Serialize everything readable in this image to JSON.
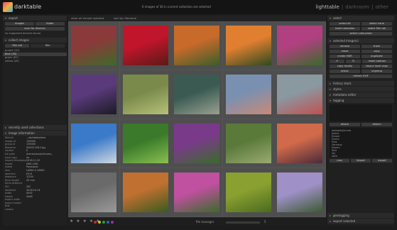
{
  "app": {
    "title": "darktable",
    "status": "6 images of 30 in current collection are selected"
  },
  "views": {
    "lighttable": "lighttable",
    "darkroom": "darkroom",
    "other": "other"
  },
  "center_top": {
    "view": "view: all except rejected",
    "sort": "sort by: filename"
  },
  "left": {
    "export": {
      "header": "export",
      "btn_images": "images",
      "btn_folder": "folder",
      "btn_scan": "scan for devices",
      "no_camera": "no supported devices found"
    },
    "collect": {
      "header": "collect images",
      "filter_label": "film roll",
      "filter_value": "film",
      "rows": [
        "purple (10)",
        "blue (20)",
        "green (87)",
        "yellow (45)"
      ]
    },
    "recent": {
      "header": "recently used collections"
    },
    "info": {
      "header": "image information",
      "rows": [
        {
          "k": "filmroll",
          "v": "...darktable/test"
        },
        {
          "k": "image id",
          "v": "135000"
        },
        {
          "k": "group id",
          "v": "135000"
        },
        {
          "k": "filename",
          "v": "DSC02128.2.jpg"
        },
        {
          "k": "version",
          "v": "0"
        },
        {
          "k": "full path",
          "v": "/home/user/pictures/..."
        },
        {
          "k": "local copy",
          "v": "no"
        },
        {
          "k": "import timestamp",
          "v": "2018.11.20"
        },
        {
          "k": "model",
          "v": "DMC-GM1"
        },
        {
          "k": "maker",
          "v": "Panasonic"
        },
        {
          "k": "lens",
          "v": "LUMIX G VARIO"
        },
        {
          "k": "aperture",
          "v": "f/5.6"
        },
        {
          "k": "exposure",
          "v": "1/250"
        },
        {
          "k": "focal length",
          "v": "42 mm"
        },
        {
          "k": "focus distance",
          "v": ""
        },
        {
          "k": "ISO",
          "v": "200"
        },
        {
          "k": "datetime",
          "v": "2018:10:14"
        },
        {
          "k": "width",
          "v": "4592"
        },
        {
          "k": "height",
          "v": "3448"
        },
        {
          "k": "export width",
          "v": ""
        },
        {
          "k": "export height",
          "v": ""
        },
        {
          "k": "title",
          "v": ""
        },
        {
          "k": "creator",
          "v": ""
        }
      ]
    }
  },
  "right": {
    "select": {
      "header": "select",
      "all": "select all",
      "none": "select none",
      "invert": "invert selection",
      "film": "select film roll",
      "untouched": "select untouched"
    },
    "selected": {
      "header": "selected image(s)",
      "remove": "remove",
      "delete": "trash",
      "move": "move",
      "copy": "copy",
      "create_hdr": "create HDR",
      "duplicate": "duplicate",
      "rotate_ccw": "↺",
      "rotate_cw": "↻",
      "reset_rotation": "reset rotation",
      "copy_locally": "copy locally",
      "resync": "resync local copy",
      "group": "group",
      "ungroup": "ungroup",
      "refresh_exif": "refresh EXIF"
    },
    "history": {
      "header": "history stack"
    },
    "styles": {
      "header": "styles"
    },
    "metadata": {
      "header": "metadata editor"
    },
    "tagging": {
      "header": "tagging",
      "attach": "attach",
      "detach": "detach",
      "new": "new",
      "import": "import",
      "export": "export",
      "tags": [
        "darktable|format",
        "places",
        "Europe",
        "France",
        "Paris",
        "Germany",
        "flowers",
        "field",
        "sky",
        "other"
      ]
    },
    "geotagging": {
      "header": "geotagging"
    },
    "export_sel": {
      "header": "export selected"
    }
  },
  "bottom": {
    "stars": "★ ★ ★ ★ ★",
    "layout": "file manager",
    "zoom_label": "5"
  },
  "colors": {
    "accent": "#b5b5b5",
    "panel": "#202020",
    "center_bg": "#555555"
  },
  "thumbnails": [
    {
      "name": "red-flowers-tree",
      "colors": [
        "#8a3a3a",
        "#3c6b2a"
      ]
    },
    {
      "name": "red-rose",
      "colors": [
        "#c0152a",
        "#5a1a18"
      ]
    },
    {
      "name": "orange-tree-garden",
      "colors": [
        "#c76a2a",
        "#3b5e2a"
      ]
    },
    {
      "name": "orange-flower",
      "colors": [
        "#e07f30",
        "#2c4a20"
      ]
    },
    {
      "name": "pink-purple-flowers",
      "colors": [
        "#b04080",
        "#3a6a2a"
      ]
    },
    {
      "name": "purple-iris",
      "colors": [
        "#5a3a7a",
        "#1b1b25"
      ]
    },
    {
      "name": "butterfly-on-plant",
      "colors": [
        "#7a8a4a",
        "#b6c27a"
      ]
    },
    {
      "name": "duck-on-water",
      "colors": [
        "#3a5a52",
        "#9aa090"
      ]
    },
    {
      "name": "seals-on-rocks",
      "colors": [
        "#7a90b0",
        "#c88a78"
      ]
    },
    {
      "name": "red-flowers-field",
      "colors": [
        "#8a98a0",
        "#c05050"
      ]
    },
    {
      "name": "mountain-sky",
      "colors": [
        "#3a7ac8",
        "#d0d8e0"
      ]
    },
    {
      "name": "green-plant",
      "colors": [
        "#3a7a2a",
        "#8ac050"
      ]
    },
    {
      "name": "purple-flowers-green",
      "colors": [
        "#7a3a8a",
        "#3a6a2a"
      ]
    },
    {
      "name": "mossy-rock",
      "colors": [
        "#5a7a3a",
        "#9aaa70"
      ]
    },
    {
      "name": "sunset-mountain",
      "colors": [
        "#d06a4a",
        "#4a2a3a"
      ]
    },
    {
      "name": "stone-wall",
      "colors": [
        "#6a6a6a",
        "#9a9a9a"
      ]
    },
    {
      "name": "butterfly-on-flower",
      "colors": [
        "#c07030",
        "#3a5a20"
      ]
    },
    {
      "name": "pink-thistle",
      "colors": [
        "#c050a0",
        "#3a6a2a"
      ]
    },
    {
      "name": "yellow-green-leaves",
      "colors": [
        "#8aa030",
        "#4a6a20"
      ]
    },
    {
      "name": "white-purple-flowers",
      "colors": [
        "#a090c8",
        "#3a5a30"
      ]
    }
  ]
}
